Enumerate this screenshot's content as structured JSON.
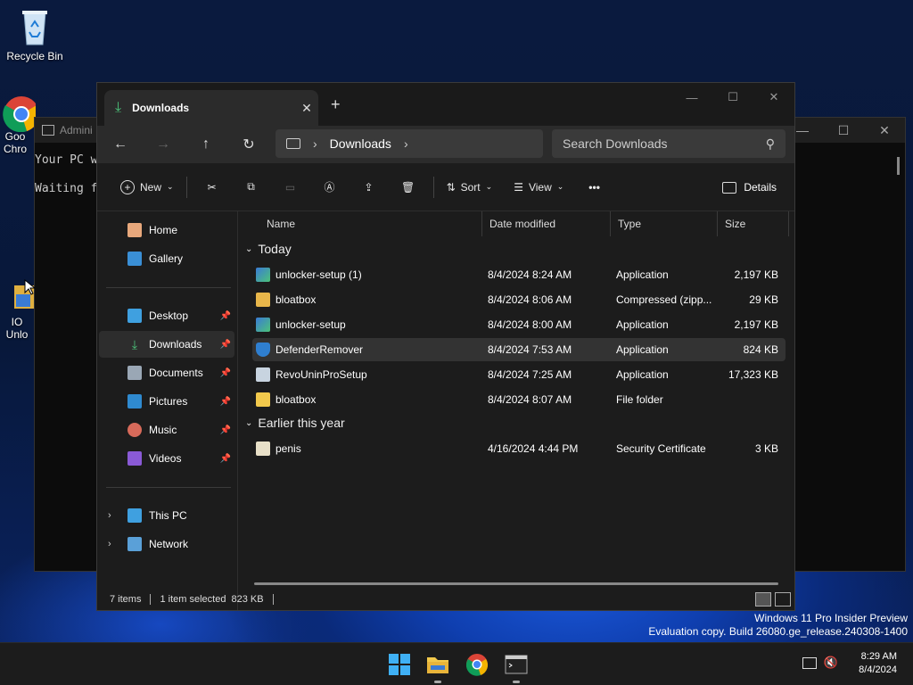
{
  "desktop": {
    "icons": [
      {
        "label": "Recycle Bin"
      },
      {
        "label": "Goo Chro"
      },
      {
        "label": "IO Unlo"
      }
    ]
  },
  "console": {
    "title": "Admini",
    "lines": [
      "Your PC w",
      "Waiting f"
    ]
  },
  "explorer": {
    "tab_title": "Downloads",
    "address": {
      "segments": [
        "Downloads"
      ]
    },
    "search_placeholder": "Search Downloads",
    "command_bar": {
      "new_label": "New",
      "sort_label": "Sort",
      "view_label": "View",
      "more_label": "•••",
      "details_label": "Details"
    },
    "nav": {
      "quick": [
        {
          "label": "Home",
          "icon": "home-icon"
        },
        {
          "label": "Gallery",
          "icon": "gallery-icon"
        }
      ],
      "pinned": [
        {
          "label": "Desktop",
          "icon": "desktop-icon"
        },
        {
          "label": "Downloads",
          "icon": "downloads-icon",
          "selected": true
        },
        {
          "label": "Documents",
          "icon": "documents-icon"
        },
        {
          "label": "Pictures",
          "icon": "pictures-icon"
        },
        {
          "label": "Music",
          "icon": "music-icon"
        },
        {
          "label": "Videos",
          "icon": "videos-icon"
        }
      ],
      "tree": [
        {
          "label": "This PC",
          "icon": "this-pc-icon"
        },
        {
          "label": "Network",
          "icon": "network-icon"
        }
      ]
    },
    "columns": [
      "Name",
      "Date modified",
      "Type",
      "Size"
    ],
    "groups": [
      {
        "label": "Today",
        "files": [
          {
            "name": "unlocker-setup (1)",
            "date": "8/4/2024 8:24 AM",
            "type": "Application",
            "size": "2,197 KB",
            "icon": "installer-icon"
          },
          {
            "name": "bloatbox",
            "date": "8/4/2024 8:06 AM",
            "type": "Compressed (zipp...",
            "size": "29 KB",
            "icon": "zip-folder-icon"
          },
          {
            "name": "unlocker-setup",
            "date": "8/4/2024 8:00 AM",
            "type": "Application",
            "size": "2,197 KB",
            "icon": "installer-icon"
          },
          {
            "name": "DefenderRemover",
            "date": "8/4/2024 7:53 AM",
            "type": "Application",
            "size": "824 KB",
            "icon": "shield-app-icon",
            "selected": true
          },
          {
            "name": "RevoUninProSetup",
            "date": "8/4/2024 7:25 AM",
            "type": "Application",
            "size": "17,323 KB",
            "icon": "setup-icon"
          },
          {
            "name": "bloatbox",
            "date": "8/4/2024 8:07 AM",
            "type": "File folder",
            "size": "",
            "icon": "folder-icon"
          }
        ]
      },
      {
        "label": "Earlier this year",
        "files": [
          {
            "name": "penis",
            "date": "4/16/2024 4:44 PM",
            "type": "Security Certificate",
            "size": "3 KB",
            "icon": "certificate-icon"
          }
        ]
      }
    ],
    "status": {
      "items": "7 items",
      "selected": "1 item selected",
      "size": "823 KB"
    }
  },
  "watermark": {
    "line1": "Windows 11 Pro Insider Preview",
    "line2": "Evaluation copy. Build 26080.ge_release.240308-1400"
  },
  "taskbar": {
    "time": "8:29 AM",
    "date": "8/4/2024"
  }
}
